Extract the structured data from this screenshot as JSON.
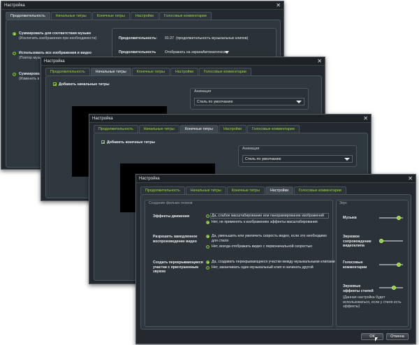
{
  "window_title": "Настройка",
  "tabs": [
    "Продолжительность",
    "Начальные титры",
    "Конечные титры",
    "Настройки",
    "Голосовые комментарии"
  ],
  "w1": {
    "opt1_title": "Суммировать для соответствия музыке",
    "opt1_sub": "(Исключить изображения при необходимости)",
    "opt2_title": "Использовать все изображения и видео",
    "opt2_sub": "(Повтор музыки",
    "opt3_title": "Суммирова",
    "opt3_sub": "(Изменить в с",
    "duration_label": "Продолжительность:",
    "duration_value": "01:27",
    "duration_note": "(продолжительность музыкальных клипов)",
    "row2_label": "Продолжительность",
    "row2_value": "Отображать на экране",
    "row2_combo": "Автоматически"
  },
  "w2": {
    "checkbox_label": "Добавить начальные титры",
    "anim_label": "Анимация",
    "combo_value": "Стиль по умолчанию"
  },
  "w3": {
    "checkbox_label": "Добавить конечные титры",
    "anim_label": "Анимация",
    "combo_value": "Стиль по умолчанию"
  },
  "w4": {
    "section_left": "Создание фильма гномов",
    "section_right": "Звук",
    "s1_title": "Эффекты движения",
    "s1_opt1": "Да, слабое масштабирование или панорамирование изображений",
    "s1_opt2": "Нет, не применять к изображению эффекты масштабирования",
    "s2_title": "Разрешить замедленное воспроизведение видео",
    "s2_opt1": "Да, уменьшить или увеличить скорость видео, если это необходимо для стиля",
    "s2_opt2": "Нет, всегда отображать видео с первоначальной скоростью",
    "s3_title": "Создать перекрывающиеся участки с приглушенным звуком",
    "s3_opt1": "Да, создавать перекрывающиеся участки между музыкальными клипами",
    "s3_opt2": "Нет, заканчивать один музыкальный клип и начинать другой",
    "audio_music": "Музыка",
    "audio_video": "Звуковое сопровождение видеоклипа",
    "audio_voice": "Голосовые комментарии",
    "audio_fx": "Звуковые эффекты стилей",
    "audio_fx_note": "(Данная настройка будет использоваться, если у стиля есть эффекты)",
    "ok_label": "ОК",
    "cancel_label": "Отмена"
  },
  "colors": {
    "accent": "#9fdc3a",
    "window": "#23292e",
    "panel": "#2f383e"
  }
}
